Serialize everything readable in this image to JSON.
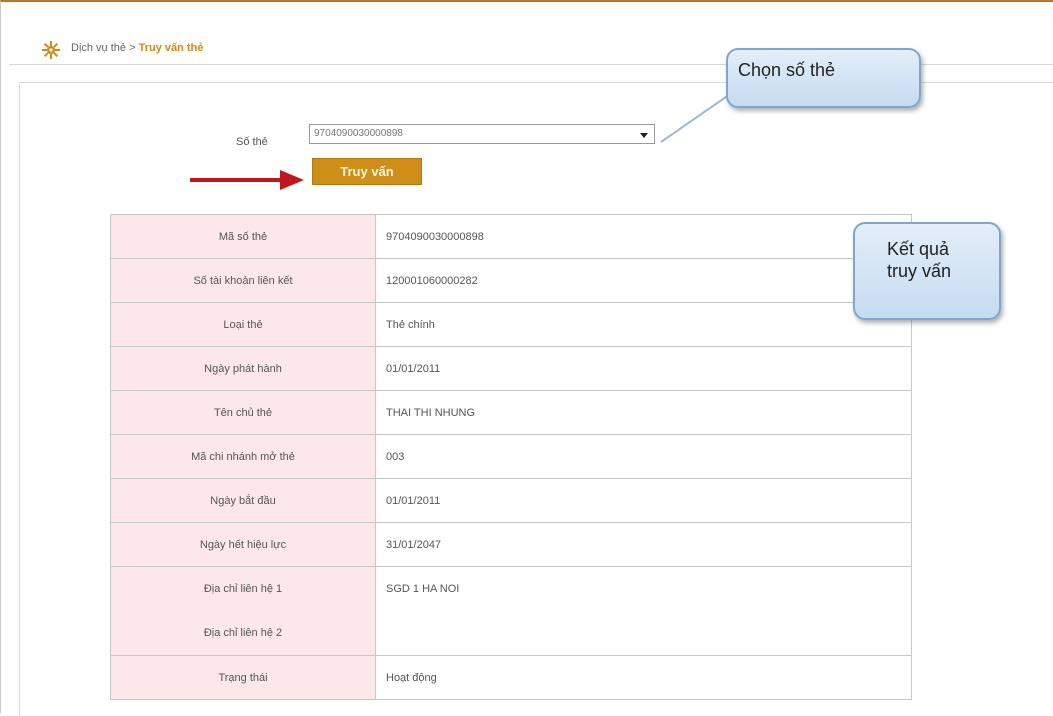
{
  "breadcrumb": {
    "parent": "Dịch vụ thẻ",
    "separator": ">",
    "current": "Truy vấn thẻ",
    "icon": "gear-icon"
  },
  "form": {
    "card_label": "Số thẻ",
    "card_selected": "9704090030000898",
    "query_button": "Truy vấn"
  },
  "callouts": {
    "select_card": "Chọn số thẻ",
    "result_line1": "Kết quả",
    "result_line2": "truy vấn"
  },
  "result_rows": [
    {
      "label": "Mã số thẻ",
      "value": "9704090030000898"
    },
    {
      "label": "Số tài khoản liên kết",
      "value": "120001060000282"
    },
    {
      "label": "Loại thẻ",
      "value": "Thẻ chính"
    },
    {
      "label": "Ngày phát hành",
      "value": "01/01/2011"
    },
    {
      "label": "Tên chủ thẻ",
      "value": "THAI THI NHUNG"
    },
    {
      "label": "Mã chi nhánh mở thẻ",
      "value": "003"
    },
    {
      "label": "Ngày bắt đầu",
      "value": "01/01/2011"
    },
    {
      "label": "Ngày hết hiệu lực",
      "value": "31/01/2047"
    }
  ],
  "address": {
    "label1": "Địa chỉ liên hệ 1",
    "label2": "Địa chỉ liên hệ 2",
    "value1": "SGD 1 HA NOI",
    "value2": ""
  },
  "status": {
    "label": "Trạng thái",
    "value": "Hoạt động"
  },
  "colors": {
    "accent": "#cf8e17",
    "label_bg": "#fce8e8",
    "callout_border": "#7ea6cf",
    "arrow": "#c0171d"
  }
}
